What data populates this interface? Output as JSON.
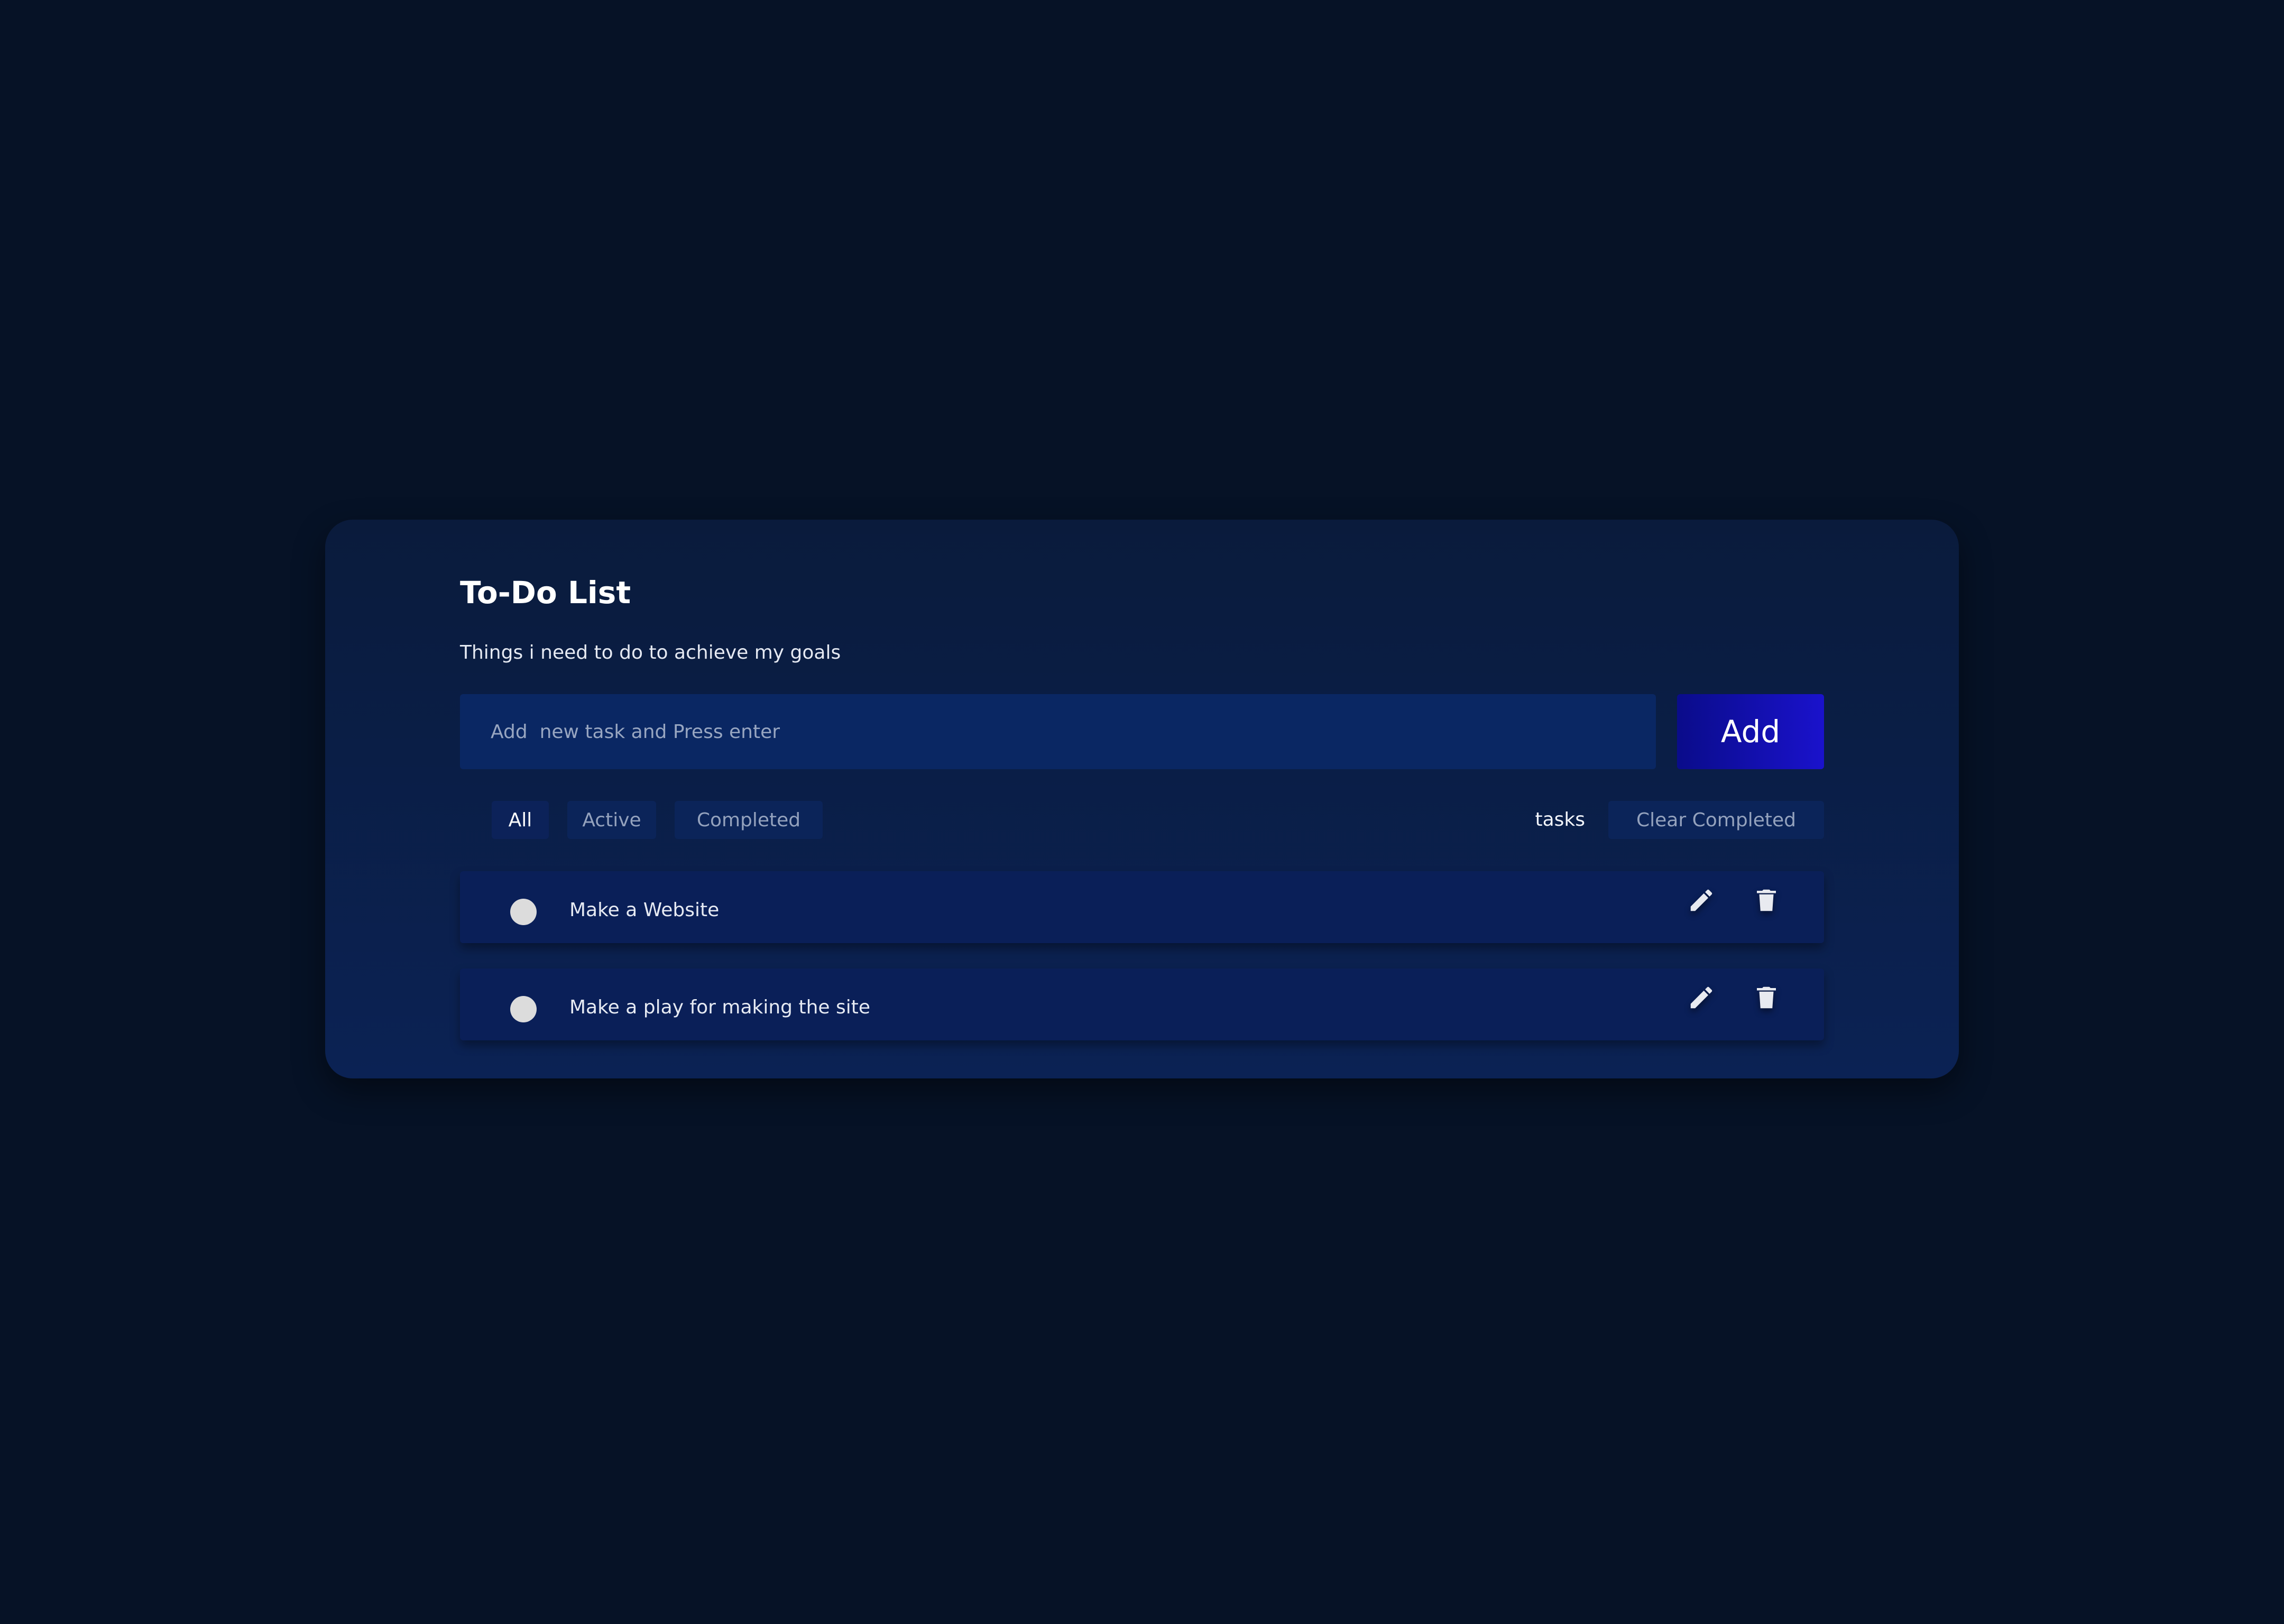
{
  "header": {
    "title": "To-Do List",
    "subtitle": "Things i need to do to achieve my goals"
  },
  "input": {
    "placeholder": "Add  new task and Press enter",
    "value": ""
  },
  "add_button": {
    "label": "Add"
  },
  "filters": {
    "all": "All",
    "active": "Active",
    "completed": "Completed",
    "selected": "All"
  },
  "tasks_label": "tasks",
  "clear_completed_label": "Clear Completed",
  "tasks": [
    {
      "text": "Make a Website",
      "completed": false
    },
    {
      "text": "Make a play for making the site",
      "completed": false
    }
  ],
  "icons": {
    "edit": "pencil-icon",
    "delete": "trash-icon",
    "checkbox": "circle-checkbox"
  },
  "colors": {
    "background": "#061226",
    "card": "#0b2254",
    "input": "#0a2763",
    "add_button": "#1a12cc",
    "task_row": "#0a1f58",
    "muted_text": "#94a2bd"
  }
}
